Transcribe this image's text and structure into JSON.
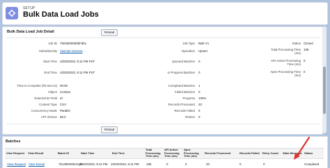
{
  "header": {
    "setup_label": "SETUP",
    "title": "Bulk Data Load Jobs"
  },
  "detail": {
    "title": "Bulk Data Load Job Detail",
    "reload_label": "Reload",
    "left_fields": [
      {
        "label": "Job ID",
        "value": "7503t000000bFdbu"
      },
      {
        "label": "Submitted By",
        "value": "Vasmati Ganotra"
      },
      {
        "label": "Start Time",
        "value": "10/20/2022, 9:11 PM PST"
      },
      {
        "label": "End Time",
        "value": "10/20/2022, 9:11 PM PST"
      },
      {
        "label": "Time to Complete (hh:mm:ss)",
        "value": "00:00"
      },
      {
        "label": "Object",
        "value": "Contact"
      },
      {
        "label": "External ID Field",
        "value": "Id"
      },
      {
        "label": "Content Type",
        "value": "CSV"
      },
      {
        "label": "Concurrency Mode",
        "value": "Parallel"
      },
      {
        "label": "API Version",
        "value": "56.0"
      }
    ],
    "mid_fields": [
      {
        "label": "Job Type",
        "value": "Bulk V1"
      },
      {
        "label": "Operation",
        "value": "Upsert"
      },
      {
        "label": "Queued Batches",
        "value": "0"
      },
      {
        "label": "In Progress Batches",
        "value": "0"
      },
      {
        "label": "Completed Batches",
        "value": "1"
      },
      {
        "label": "Failed Batches",
        "value": "0"
      },
      {
        "label": "Progress",
        "value": "100%"
      },
      {
        "label": "Records Processed",
        "value": "20"
      },
      {
        "label": "Records Failed",
        "value": "0"
      },
      {
        "label": "Retries",
        "value": "0"
      }
    ],
    "right_fields": [
      {
        "label": "Status",
        "value": "Closed"
      },
      {
        "label": "Total Processing Time (ms)",
        "value": "159"
      },
      {
        "label": "API Active Processing Time (ms)",
        "value": "0"
      },
      {
        "label": "Apex Processing Time (ms)",
        "value": "0"
      }
    ]
  },
  "batches": {
    "title": "Batches",
    "columns": [
      "View Request",
      "View Result",
      "Batch ID",
      "Start Time",
      "End Time",
      "Total Processing Time (ms)",
      "API Active Processing Time (ms)",
      "Apex Processing Time (ms)",
      "Records Processed",
      "Records Failed",
      "Retry Count",
      "State Message",
      "Status"
    ],
    "row": {
      "view_request": "View Request",
      "view_result": "View Result",
      "batch_id": "7513t00000cOyl5",
      "start": "10/20/2022, 9:11 PM",
      "end": "10/20/2022, 9:11 PM",
      "total": "159",
      "api": "0",
      "apex": "0",
      "processed": "20",
      "failed": "0",
      "retry": "0",
      "state": "",
      "status": "Completed"
    }
  },
  "colors": {
    "background": "#b0c4df",
    "link": "#0b5cab",
    "app_icon": "#7f8de1",
    "annotation_arrow": "#e03131"
  },
  "icons": {
    "app": "gear-icon"
  }
}
